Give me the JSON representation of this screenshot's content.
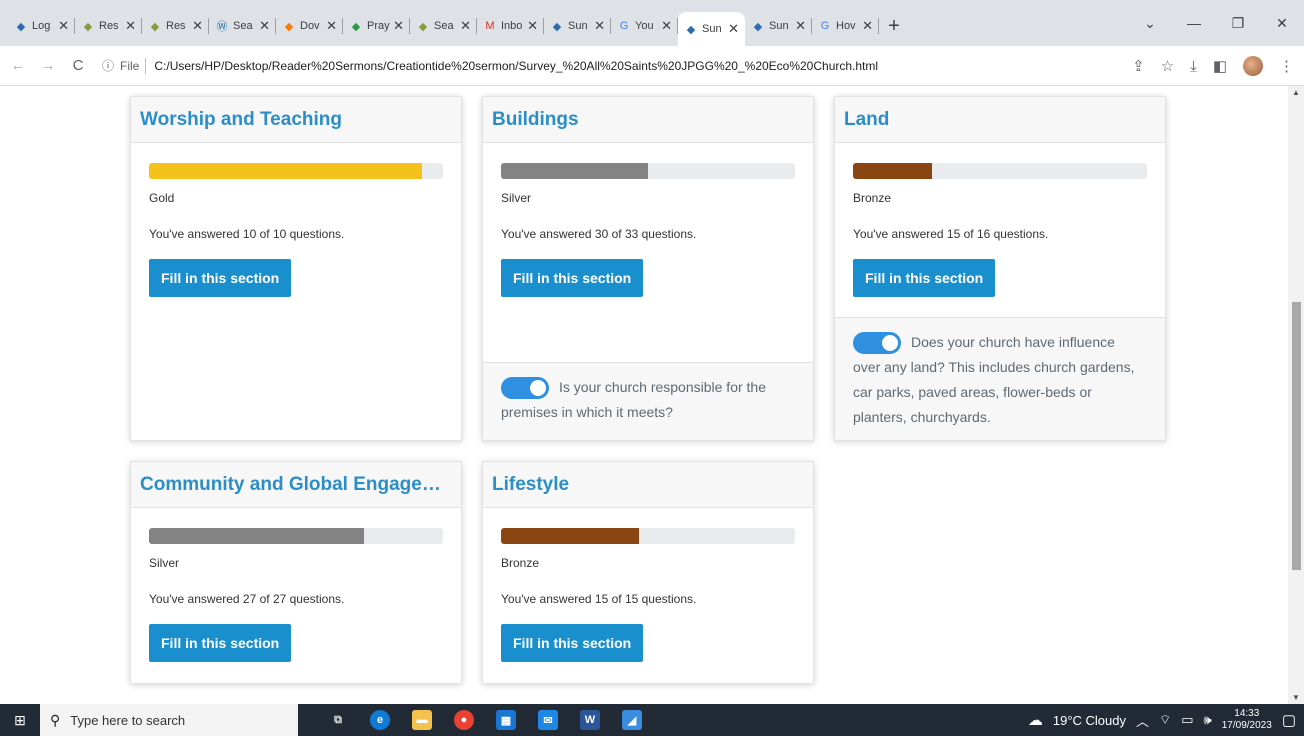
{
  "browser": {
    "tabs": [
      {
        "label": "Log",
        "icon": "survey-icon",
        "color": "#2b6cb0"
      },
      {
        "label": "Res",
        "icon": "ecochurch-icon",
        "color": "#8a9b3d"
      },
      {
        "label": "Res",
        "icon": "ecochurch-icon",
        "color": "#8a9b3d"
      },
      {
        "label": "Sea",
        "icon": "wordpress-icon",
        "color": "#1f6fa8"
      },
      {
        "label": "Dov",
        "icon": "download-icon",
        "color": "#f57c00"
      },
      {
        "label": "Pray",
        "icon": "drive-icon",
        "color": "#2a9d4a"
      },
      {
        "label": "Sea",
        "icon": "ecochurch-icon",
        "color": "#8a9b3d"
      },
      {
        "label": "Inbo",
        "icon": "gmail-icon",
        "color": "#d93025"
      },
      {
        "label": "Sun",
        "icon": "survey-icon",
        "color": "#2b6cb0"
      },
      {
        "label": "You",
        "icon": "google-icon",
        "color": "#4285f4"
      },
      {
        "label": "Sun",
        "icon": "survey-icon",
        "color": "#2b6cb0",
        "active": true
      },
      {
        "label": "Sun",
        "icon": "survey-icon",
        "color": "#2b6cb0"
      },
      {
        "label": "Hov",
        "icon": "google-icon",
        "color": "#4285f4"
      }
    ],
    "new_tab": "+",
    "file_label": "File",
    "url": "C:/Users/HP/Desktop/Reader%20Sermons/Creationtide%20sermon/Survey_%20All%20Saints%20JPGG%20_%20Eco%20Church.html"
  },
  "cards": [
    {
      "title": "Worship and Teaching",
      "level": "Gold",
      "progress": 0.93,
      "bar_color": "#f5c11b",
      "answered": "You've answered 10 of 10 questions.",
      "button": "Fill in this section"
    },
    {
      "title": "Buildings",
      "level": "Silver",
      "progress": 0.5,
      "bar_color": "#838383",
      "answered": "You've answered 30 of 33 questions.",
      "button": "Fill in this section",
      "footer": "Is your church responsible for the premises in which it meets?"
    },
    {
      "title": "Land",
      "level": "Bronze",
      "progress": 0.27,
      "bar_color": "#8b4513",
      "answered": "You've answered 15 of 16 questions.",
      "button": "Fill in this section",
      "footer": "Does your church have influence over any land? This includes church gardens, car parks, paved areas, flower-beds or planters, churchyards."
    },
    {
      "title": "Community and Global Engagement",
      "level": "Silver",
      "progress": 0.73,
      "bar_color": "#838383",
      "answered": "You've answered 27 of 27 questions.",
      "button": "Fill in this section"
    },
    {
      "title": "Lifestyle",
      "level": "Bronze",
      "progress": 0.47,
      "bar_color": "#8b4513",
      "answered": "You've answered 15 of 15 questions.",
      "button": "Fill in this section"
    }
  ],
  "taskbar": {
    "search_placeholder": "Type here to search",
    "weather": "19°C  Cloudy",
    "time": "14:33",
    "date": "17/09/2023"
  }
}
